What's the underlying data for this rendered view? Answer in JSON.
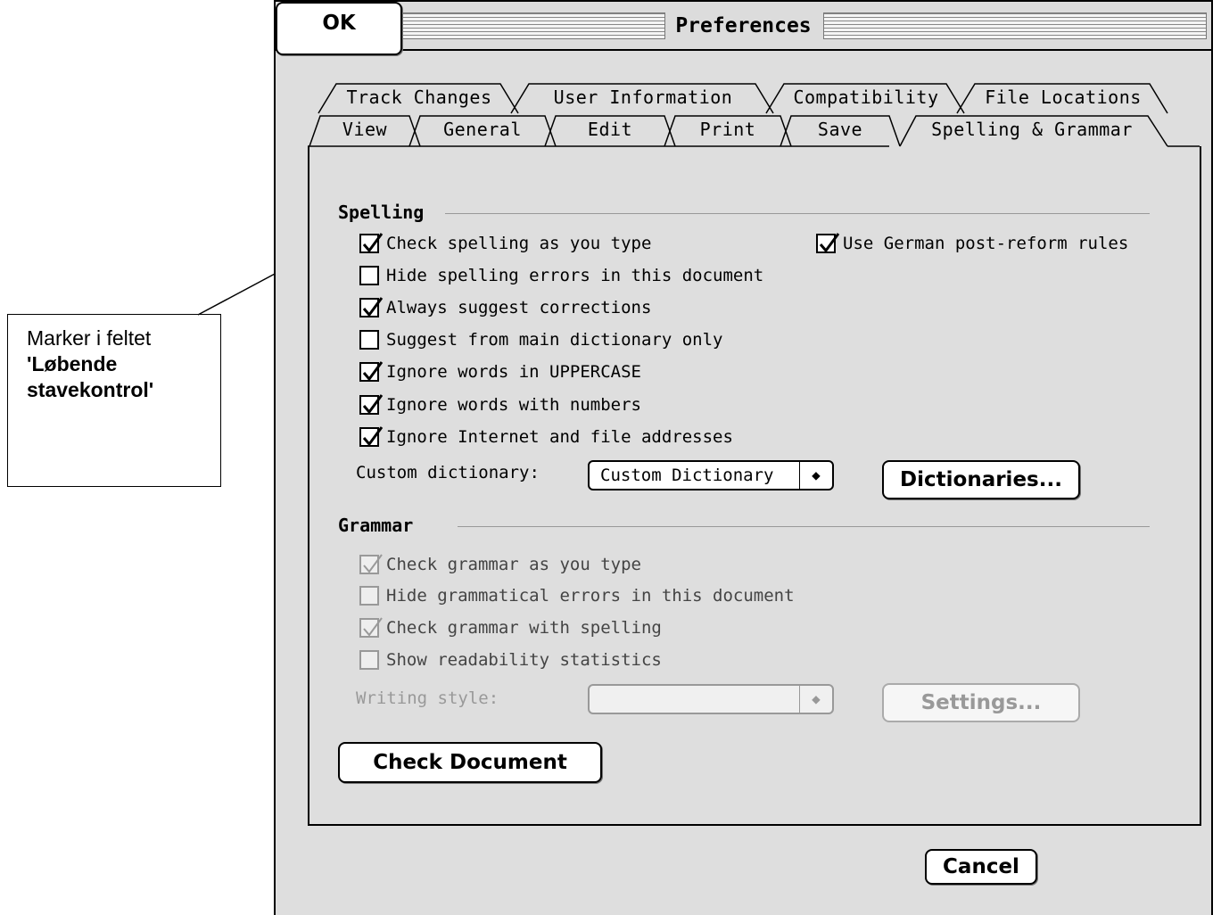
{
  "callout": {
    "line1": "Marker i feltet",
    "line2": "'Løbende",
    "line3": "stavekontrol'"
  },
  "window": {
    "title": "Preferences"
  },
  "tabs_back": [
    "Track Changes",
    "User Information",
    "Compatibility",
    "File Locations"
  ],
  "tabs_front": [
    "View",
    "General",
    "Edit",
    "Print",
    "Save",
    "Spelling & Grammar"
  ],
  "active_tab": "Spelling & Grammar",
  "spelling": {
    "heading": "Spelling",
    "options": [
      {
        "label": "Check spelling as you type",
        "checked": true
      },
      {
        "label": "Hide spelling errors in this document",
        "checked": false
      },
      {
        "label": "Always suggest corrections",
        "checked": true
      },
      {
        "label": "Suggest from main dictionary only",
        "checked": false
      },
      {
        "label": "Ignore words in UPPERCASE",
        "checked": true
      },
      {
        "label": "Ignore words with numbers",
        "checked": true
      },
      {
        "label": "Ignore Internet and file addresses",
        "checked": true
      }
    ],
    "german": {
      "label": "Use German post-reform rules",
      "checked": true
    },
    "custom_dictionary_label": "Custom dictionary:",
    "custom_dictionary_value": "Custom Dictionary",
    "dictionaries_button": "Dictionaries..."
  },
  "grammar": {
    "heading": "Grammar",
    "options": [
      {
        "label": "Check grammar as you type",
        "checked": true
      },
      {
        "label": "Hide grammatical errors in this document",
        "checked": false
      },
      {
        "label": "Check grammar with spelling",
        "checked": true
      },
      {
        "label": "Show readability statistics",
        "checked": false
      }
    ],
    "writing_style_label": "Writing style:",
    "writing_style_value": "",
    "settings_button": "Settings..."
  },
  "check_document_button": "Check Document",
  "cancel_button": "Cancel",
  "ok_button": "OK"
}
